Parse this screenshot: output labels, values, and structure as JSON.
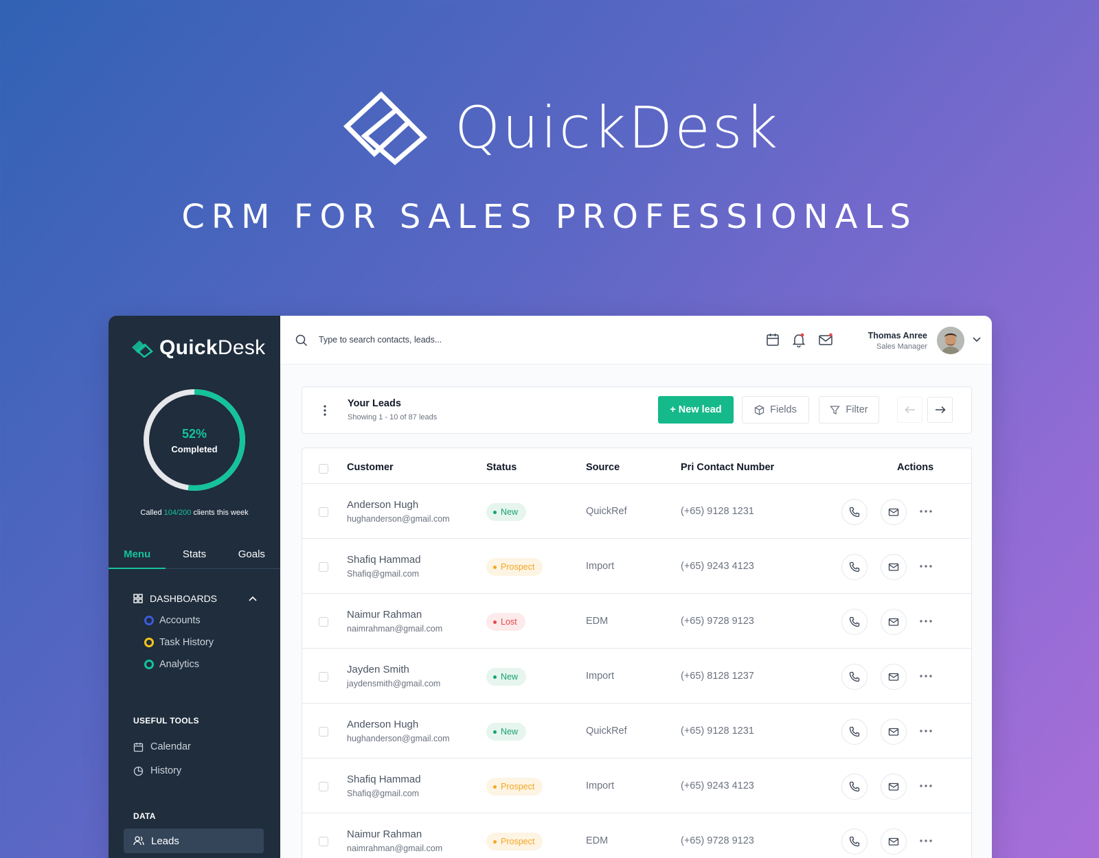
{
  "hero": {
    "title": "QuickDesk",
    "tagline": "CRM FOR SALES PROFESSIONALS"
  },
  "colors": {
    "accent": "#15c39a",
    "sidebar_bg": "#1f2d3d",
    "status_new": "#15a374",
    "status_prospect": "#f5a623",
    "status_lost": "#e5484d"
  },
  "sidebar": {
    "brand_bold": "Quick",
    "brand_light": "Desk",
    "progress": {
      "percent": 0.52,
      "percent_label": "52%",
      "label": "Completed"
    },
    "called": {
      "prefix": "Called ",
      "count": "104/200",
      "suffix": " clients this week"
    },
    "tabs": [
      {
        "label": "Menu",
        "active": true
      },
      {
        "label": "Stats",
        "active": false
      },
      {
        "label": "Goals",
        "active": false
      }
    ],
    "dashboards": {
      "label": "DASHBOARDS",
      "items": [
        {
          "label": "Accounts",
          "color": "#3b5bdb"
        },
        {
          "label": "Task History",
          "color": "#f5c518"
        },
        {
          "label": "Analytics",
          "color": "#15c39a"
        }
      ]
    },
    "useful_tools": {
      "label": "USEFUL TOOLS",
      "items": [
        {
          "label": "Calendar",
          "icon": "calendar-icon"
        },
        {
          "label": "History",
          "icon": "pie-chart-icon"
        }
      ]
    },
    "data_section": {
      "label": "DATA",
      "items": [
        {
          "label": "Leads",
          "icon": "users-icon",
          "active": true
        }
      ]
    }
  },
  "topbar": {
    "search_placeholder": "Type to search contacts, leads...",
    "user_name": "Thomas Anree",
    "user_role": "Sales Manager"
  },
  "leads_header": {
    "title": "Your Leads",
    "subtitle": "Showing 1 - 10 of 87 leads",
    "new_lead_label": "+ New lead",
    "fields_label": "Fields",
    "filter_label": "Filter"
  },
  "table": {
    "columns": [
      "Customer",
      "Status",
      "Source",
      "Pri Contact Number",
      "Actions"
    ],
    "rows": [
      {
        "name": "Anderson Hugh",
        "email": "hughanderson@gmail.com",
        "status": "New",
        "status_key": "new",
        "source": "QuickRef",
        "phone": "(+65) 9128 1231"
      },
      {
        "name": "Shafiq Hammad",
        "email": "Shafiq@gmail.com",
        "status": "Prospect",
        "status_key": "prospect",
        "source": "Import",
        "phone": "(+65) 9243 4123"
      },
      {
        "name": "Naimur Rahman",
        "email": "naimrahman@gmail.com",
        "status": "Lost",
        "status_key": "lost",
        "source": "EDM",
        "phone": "(+65) 9728 9123"
      },
      {
        "name": "Jayden Smith",
        "email": "jaydensmith@gmail.com",
        "status": "New",
        "status_key": "new",
        "source": "Import",
        "phone": "(+65) 8128 1237"
      },
      {
        "name": "Anderson Hugh",
        "email": "hughanderson@gmail.com",
        "status": "New",
        "status_key": "new",
        "source": "QuickRef",
        "phone": "(+65) 9128 1231"
      },
      {
        "name": "Shafiq Hammad",
        "email": "Shafiq@gmail.com",
        "status": "Prospect",
        "status_key": "prospect",
        "source": "Import",
        "phone": "(+65) 9243 4123"
      },
      {
        "name": "Naimur Rahman",
        "email": "naimrahman@gmail.com",
        "status": "Prospect",
        "status_key": "prospect",
        "source": "EDM",
        "phone": "(+65) 9728 9123"
      }
    ]
  }
}
